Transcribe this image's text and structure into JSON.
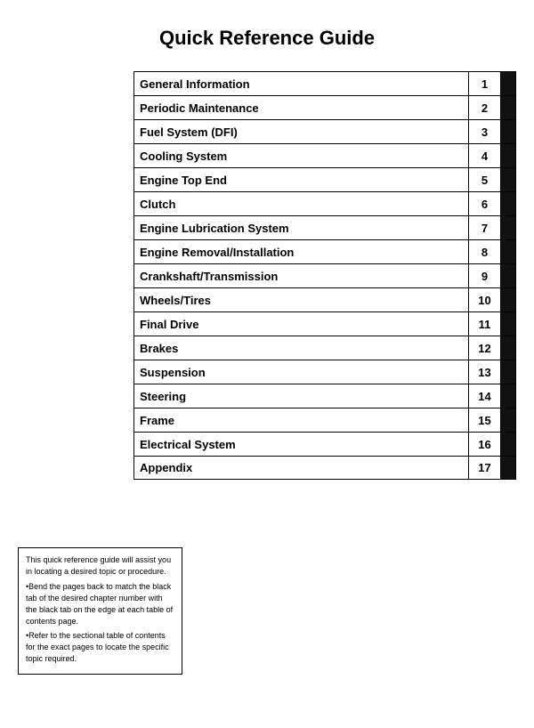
{
  "page": {
    "title": "Quick Reference Guide"
  },
  "toc": {
    "items": [
      {
        "label": "General Information",
        "number": "1"
      },
      {
        "label": "Periodic Maintenance",
        "number": "2"
      },
      {
        "label": "Fuel System (DFI)",
        "number": "3"
      },
      {
        "label": "Cooling System",
        "number": "4"
      },
      {
        "label": "Engine Top End",
        "number": "5"
      },
      {
        "label": "Clutch",
        "number": "6"
      },
      {
        "label": "Engine Lubrication System",
        "number": "7"
      },
      {
        "label": "Engine Removal/Installation",
        "number": "8"
      },
      {
        "label": "Crankshaft/Transmission",
        "number": "9"
      },
      {
        "label": "Wheels/Tires",
        "number": "10"
      },
      {
        "label": "Final Drive",
        "number": "11"
      },
      {
        "label": "Brakes",
        "number": "12"
      },
      {
        "label": "Suspension",
        "number": "13"
      },
      {
        "label": "Steering",
        "number": "14"
      },
      {
        "label": "Frame",
        "number": "15"
      },
      {
        "label": "Electrical System",
        "number": "16"
      },
      {
        "label": "Appendix",
        "number": "17"
      }
    ]
  },
  "note": {
    "text": "This quick reference guide will assist you in locating a desired topic or procedure.\n•Bend the pages back to match the black tab of the desired chapter number with the black tab on the edge at each table of contents page.\n•Refer to the sectional table of contents for the exact pages to locate the specific topic required."
  }
}
